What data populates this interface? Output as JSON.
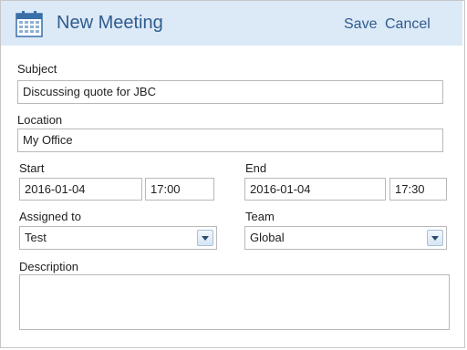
{
  "header": {
    "title": "New Meeting",
    "icon": "calendar-icon",
    "save_label": "Save",
    "cancel_label": "Cancel"
  },
  "form": {
    "subject": {
      "label": "Subject",
      "value": "Discussing quote for JBC"
    },
    "location": {
      "label": "Location",
      "value": "My Office"
    },
    "start": {
      "label": "Start",
      "date": "2016-01-04",
      "time": "17:00"
    },
    "end": {
      "label": "End",
      "date": "2016-01-04",
      "time": "17:30"
    },
    "assigned_to": {
      "label": "Assigned to",
      "value": "Test"
    },
    "team": {
      "label": "Team",
      "value": "Global"
    },
    "description": {
      "label": "Description",
      "value": ""
    }
  },
  "colors": {
    "header_bg": "#dce9f7",
    "accent": "#2e5c8e"
  }
}
